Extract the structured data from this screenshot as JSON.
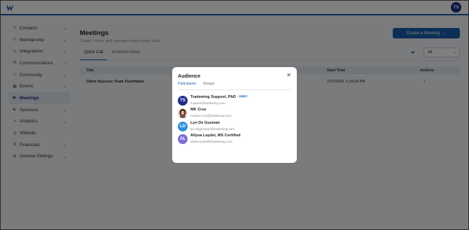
{
  "topbar": {
    "avatar_initials": "TS",
    "avatar_color": "#1e2a8a",
    "accent": "#1b5fae"
  },
  "sidebar": {
    "items": [
      {
        "label": "Contacts",
        "icon": "person-icon",
        "has_chevron": true
      },
      {
        "label": "Membership",
        "icon": "people-icon",
        "has_chevron": true
      },
      {
        "label": "Integrations",
        "icon": "link-icon",
        "has_chevron": true
      },
      {
        "label": "Communications",
        "icon": "mail-icon",
        "has_chevron": true
      },
      {
        "label": "Community",
        "icon": "chat-icon",
        "has_chevron": true
      },
      {
        "label": "Events",
        "icon": "calendar-icon",
        "has_chevron": true
      },
      {
        "label": "Meetings",
        "icon": "video-icon",
        "has_chevron": false,
        "active": true
      },
      {
        "label": "Sponsors",
        "icon": "handshake-icon",
        "has_chevron": true
      },
      {
        "label": "Analytics",
        "icon": "chart-icon",
        "has_chevron": true
      },
      {
        "label": "Website",
        "icon": "globe-icon",
        "has_chevron": false
      },
      {
        "label": "Financials",
        "icon": "dollar-icon",
        "has_chevron": true
      },
      {
        "label": "General Settings",
        "icon": "gear-icon",
        "has_chevron": true
      }
    ]
  },
  "main": {
    "title": "Meetings",
    "subtitle": "Create, share, and manage instant video calls.",
    "create_button": "Create a Meeting",
    "tabs": [
      "Quick Call",
      "Schedule Meet"
    ],
    "filter_value": "All",
    "columns": {
      "title": "Title",
      "start_time": "Start Time",
      "actions": "Actions"
    },
    "rows": [
      {
        "title": "Client Success Team Touchbase",
        "start_time": "7/27/2026, 1:24:24 PM"
      }
    ]
  },
  "modal": {
    "title": "Audience",
    "tabs": [
      "Participants",
      "Groups"
    ],
    "participants": [
      {
        "initials": "TS",
        "name": "Tradewing Support, PhD",
        "badge": "HOST",
        "email": "support@tradewing.com",
        "color": "#1e2a8a"
      },
      {
        "initials": "",
        "name": "MK Cruz",
        "badge": "",
        "email": "marian.cruz@tradewing.com",
        "color": "#6b4a3a"
      },
      {
        "initials": "LD",
        "name": "Lyn De Guzman",
        "badge": "",
        "email": "lyn.deguzman@tradewing.com",
        "color": "#2f8fd8"
      },
      {
        "initials": "AL",
        "name": "Allysa Laydel, MS Certified",
        "badge": "",
        "email": "allysa.laydel@tradewing.com",
        "color": "#7b6fd6"
      }
    ]
  }
}
